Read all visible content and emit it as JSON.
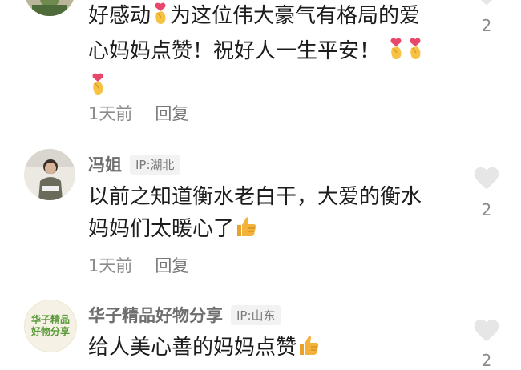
{
  "comments": [
    {
      "text_line1": "好感动",
      "text_line1b": "为这位伟大豪气有格局的爱",
      "text_line2": "心妈妈点赞！祝好人一生平安！",
      "time": "1天前",
      "reply_label": "回复",
      "like_count": "2",
      "emoji": "finger-heart"
    },
    {
      "user": "冯姐",
      "ip": "IP:湖北",
      "text_line1": "以前之知道衡水老白干，大爱的衡水",
      "text_line2": "妈妈们太暖心了",
      "time": "1天前",
      "reply_label": "回复",
      "like_count": "2",
      "emoji": "thumbs-up"
    },
    {
      "user": "华子精品好物分享",
      "ip": "IP:山东",
      "avatar_text_line1": "华子精品",
      "avatar_text_line2": "好物分享",
      "text_line1": "给人美心善的妈妈点赞",
      "like_count": "2",
      "emoji": "thumbs-up"
    }
  ],
  "colors": {
    "text": "#1c1c1c",
    "meta": "#8c8c8c",
    "heart": "#e6e6e6",
    "finger_heart": "#f5c242",
    "thumb": "#f3b23a"
  }
}
